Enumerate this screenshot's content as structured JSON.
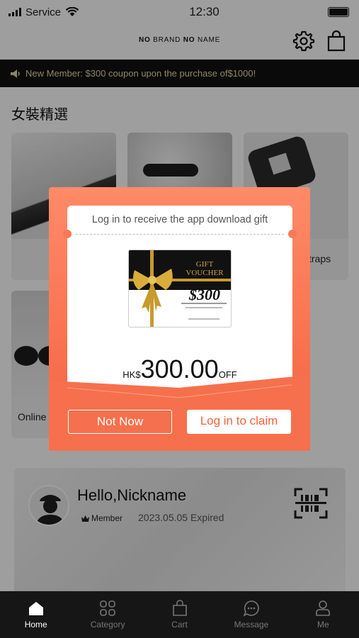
{
  "status_bar": {
    "carrier": "Service",
    "time": "12:30"
  },
  "header": {
    "brand_part1": "NO",
    "brand_part2": "BRAND",
    "brand_part3": "NO",
    "brand_part4": "NAME",
    "settings_icon": "gear-icon",
    "bag_icon": "shopping-bag-icon"
  },
  "announcement": {
    "icon": "megaphone-icon",
    "text": "New Member: $300 coupon upon the purchase of$1000!"
  },
  "section": {
    "title": "女裝精選"
  },
  "categories": [
    {
      "label": ""
    },
    {
      "label": ""
    },
    {
      "label": "traps"
    },
    {
      "label": "Online"
    }
  ],
  "member": {
    "greeting": "Hello,Nickname",
    "level": "Member",
    "expiry": "2023.05.05 Expired",
    "scan_icon": "barcode-scan-icon"
  },
  "tabbar": {
    "items": [
      {
        "label": "Home",
        "icon": "home-icon",
        "active": true
      },
      {
        "label": "Category",
        "icon": "grid-icon",
        "active": false
      },
      {
        "label": "Cart",
        "icon": "bag-icon",
        "active": false
      },
      {
        "label": "Message",
        "icon": "chat-icon",
        "active": false
      },
      {
        "label": "Me",
        "icon": "person-icon",
        "active": false
      }
    ]
  },
  "modal": {
    "title": "Log in to receive the app download gift",
    "voucher_heading": "GIFT VOUCHER",
    "voucher_amount": "$300",
    "currency": "HK$",
    "amount": "300.00",
    "suffix": "OFF",
    "dismiss_label": "Not Now",
    "claim_label": "Log in to claim"
  },
  "colors": {
    "accent": "#f4623f",
    "announcement_text": "#e6d6a6",
    "tabbar": "#161616"
  }
}
